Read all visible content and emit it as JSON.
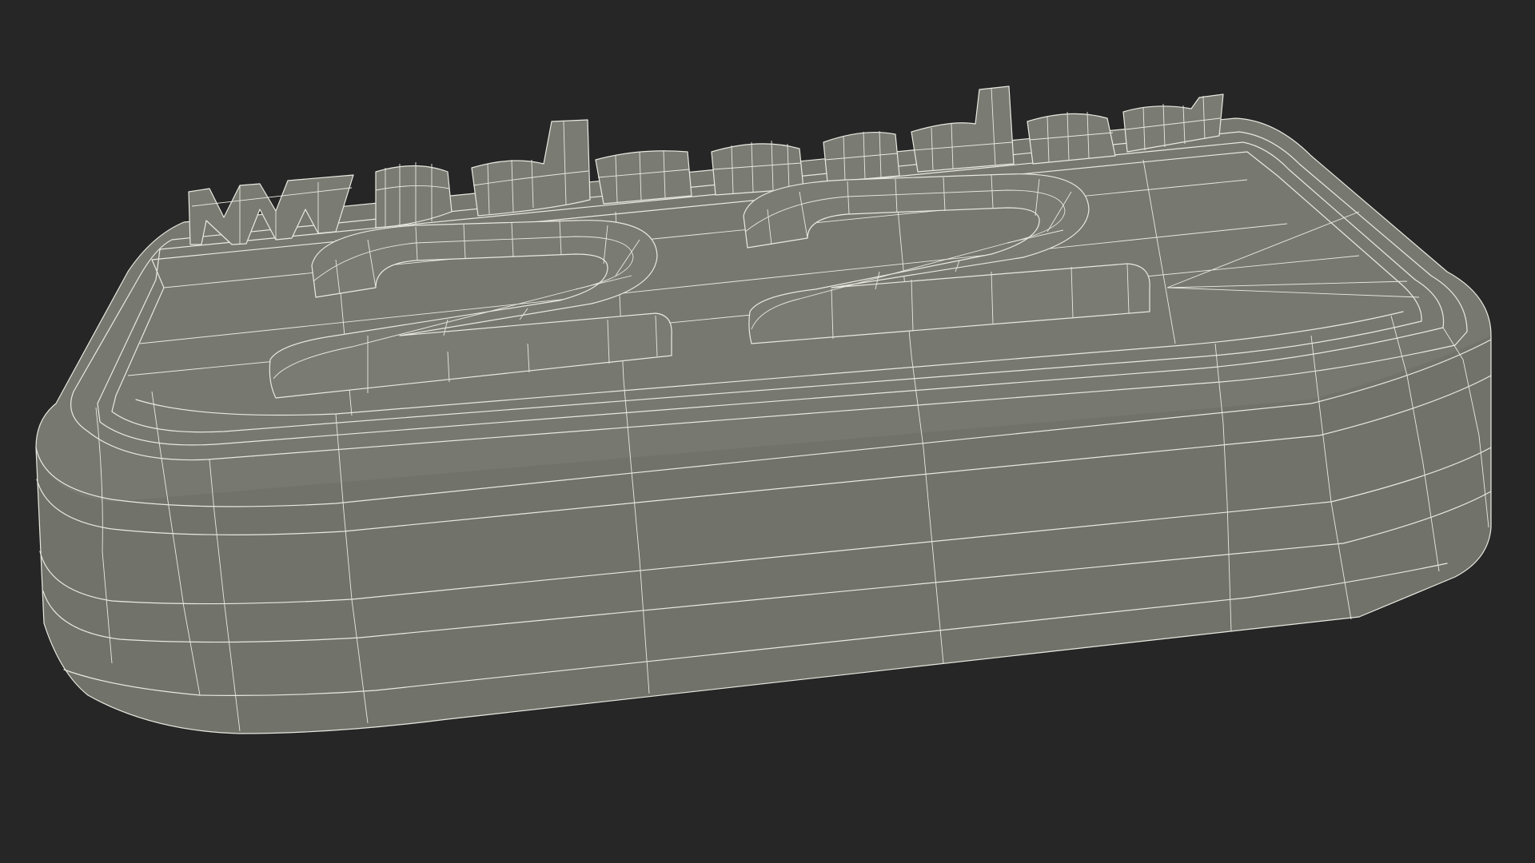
{
  "scene": {
    "background_color": "#262626",
    "mesh_color": "#777870",
    "mesh_side_color": "#71726a",
    "wireframe_color": "#e9e9e2",
    "render_mode": "wireframe-on-shaded"
  },
  "model": {
    "embossed_word": "Wednesday",
    "embossed_number": "22"
  }
}
